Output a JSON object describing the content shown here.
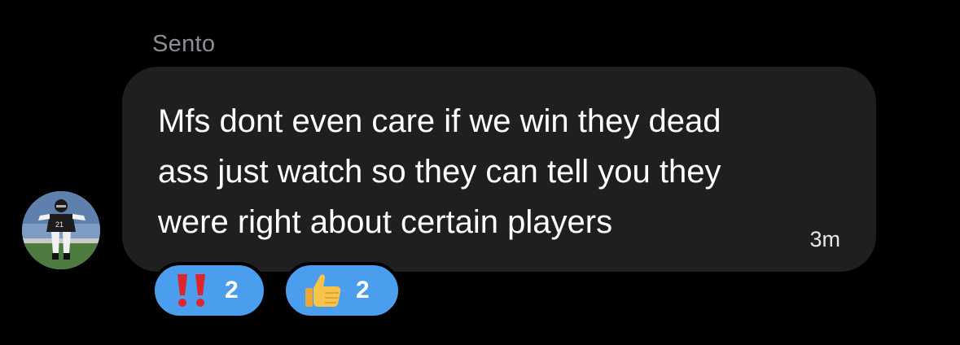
{
  "message": {
    "sender": "Sento",
    "text_lines": [
      "Mfs dont even care if we win they dead",
      "ass just watch so they can tell you they",
      "were right about certain players"
    ],
    "timestamp": "3m",
    "avatar": "football-player-avatar"
  },
  "reactions": [
    {
      "emoji": "double-exclamation-icon",
      "count": "2"
    },
    {
      "emoji": "thumbs-up-icon",
      "count": "2"
    }
  ],
  "colors": {
    "background": "#000000",
    "bubble": "#1f1f21",
    "reaction_pill": "#4a9eed",
    "sender_name": "#8b8f94",
    "exclamation": "#e0242b",
    "thumbs_up": "#f7c34a"
  }
}
